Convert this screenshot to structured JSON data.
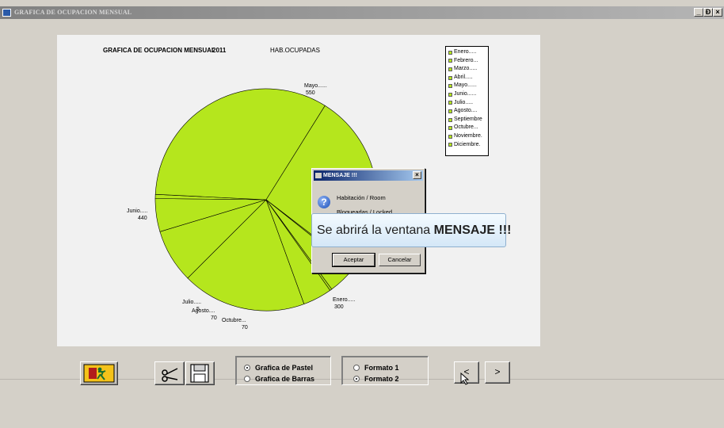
{
  "window": {
    "title": "GRAFICA DE OCUPACION MENSUAL",
    "minimize": "_",
    "maximize": "Ɖ",
    "close": "×"
  },
  "chart": {
    "title": "GRAFICA DE OCUPACION MENSUAL",
    "year": "2011",
    "subtitle": "HAB.OCUPADAS"
  },
  "chart_data": {
    "type": "pie",
    "title": "GRAFICA DE OCUPACION MENSUAL 2011",
    "subtitle": "HAB.OCUPADAS",
    "color": "#b5e61d",
    "legend": [
      "Enero.....",
      "Febrero...",
      "Marzo.....",
      "Abril.....",
      "Mayo......",
      "Junio......",
      "Julio.....",
      "Agosto....",
      "Septiembre",
      "Octubre...",
      "Noviembre.",
      "Diciembre."
    ],
    "legend_position": "top-right",
    "slices": [
      {
        "label": "Enero.....",
        "value": 300
      },
      {
        "label": "Febrero...",
        "value": 130
      },
      {
        "label": "Marzo.....",
        "value": 80
      },
      {
        "label": "Abril.....",
        "value": 10
      },
      {
        "label": "Mayo......",
        "value": 550
      },
      {
        "label": "Junio.....",
        "value": 440
      },
      {
        "label": "Julio.....",
        "value": 5
      },
      {
        "label": "Agosto....",
        "value": 70
      },
      {
        "label": "Septiembre",
        "value": 5
      },
      {
        "label": "Octubre...",
        "value": 70
      },
      {
        "label": "Noviembre.",
        "value": 0
      },
      {
        "label": "Diciembre.",
        "value": 0
      }
    ],
    "labels": {
      "mayo_name": "Mayo......",
      "mayo_value": "550",
      "junio_name": "Junio.....",
      "junio_value": "440",
      "julio_name": "Julio.....",
      "julio_value": "5",
      "agosto_name": "Agosto....",
      "agosto_value": "70",
      "octubre_name": "Octubre...",
      "octubre_value": "70",
      "enero_name": "Enero.....",
      "enero_value": "300"
    }
  },
  "dialog": {
    "title": "MENSAJE !!!",
    "line1": "Habitación / Room",
    "line2": "Bloqueadas / Locked",
    "accept": "Aceptar",
    "cancel": "Cancelar",
    "close": "×"
  },
  "tooltip": {
    "text": "Se abrirá la ventana ",
    "bold": "MENSAJE !!!"
  },
  "options": {
    "chart_type": [
      {
        "label": "Grafica de Pastel",
        "checked": true
      },
      {
        "label": "Grafica de Barras",
        "checked": false
      }
    ],
    "format": [
      {
        "label": "Formato 1",
        "checked": false
      },
      {
        "label": "Formato 2",
        "checked": true
      }
    ]
  },
  "nav": {
    "prev": "<",
    "next": ">"
  },
  "icons": {
    "exit": "exit-icon",
    "cut": "scissors-icon",
    "save": "floppy-disk-icon"
  }
}
